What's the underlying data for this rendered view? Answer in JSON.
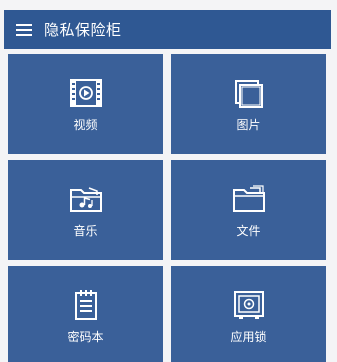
{
  "appbar": {
    "title": "隐私保险柜",
    "menu_icon": "menu-icon"
  },
  "tiles": [
    {
      "label": "视频",
      "icon": "video-icon"
    },
    {
      "label": "图片",
      "icon": "pictures-icon"
    },
    {
      "label": "音乐",
      "icon": "music-folder-icon"
    },
    {
      "label": "文件",
      "icon": "folder-icon"
    },
    {
      "label": "密码本",
      "icon": "notepad-icon"
    },
    {
      "label": "应用锁",
      "icon": "safe-icon"
    }
  ],
  "colors": {
    "appbar": "#2f5893",
    "tile": "#3a6099",
    "text": "#ffffff"
  }
}
